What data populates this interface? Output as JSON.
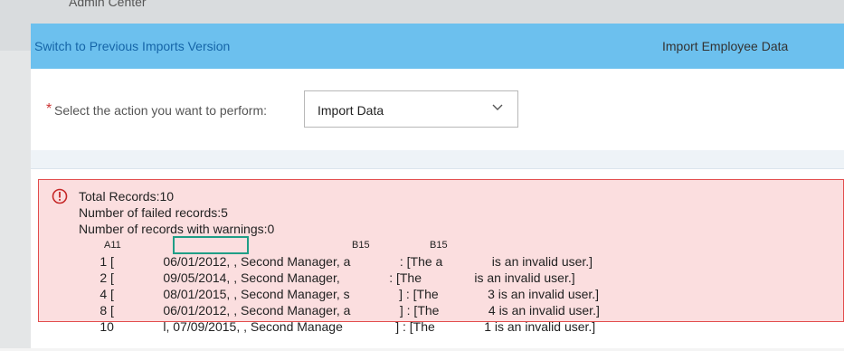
{
  "admin_title": "Admin Center",
  "header": {
    "switch_link": "Switch to Previous Imports Version",
    "page_title": "Import Employee Data"
  },
  "action": {
    "required_mark": "*",
    "label": "Select the action you want to perform:",
    "selected": "Import Data"
  },
  "result": {
    "total": "Total Records:10",
    "failed": "Number of failed records:5",
    "warnings": "Number of records with warnings:0",
    "rows": [
      {
        "text": "1 [              06/01/2012, , Second Manager, a              : [The a              is an invalid user.]"
      },
      {
        "text": "2 [              09/05/2014, , Second Manager,              : [The               is an invalid user.]"
      },
      {
        "text": "4 [              08/01/2015, , Second Manager, s              ] : [The              3 is an invalid user.]"
      },
      {
        "text": "8 [              06/01/2012, , Second Manager, a              ] : [The              4 is an invalid user.]"
      },
      {
        "text": "10              l, 07/09/2015, , Second Manage               ] : [The              1 is an invalid user.]"
      }
    ],
    "tag_a11": "A11",
    "tag_b15_1": "B15",
    "tag_b15_2": "B15"
  }
}
